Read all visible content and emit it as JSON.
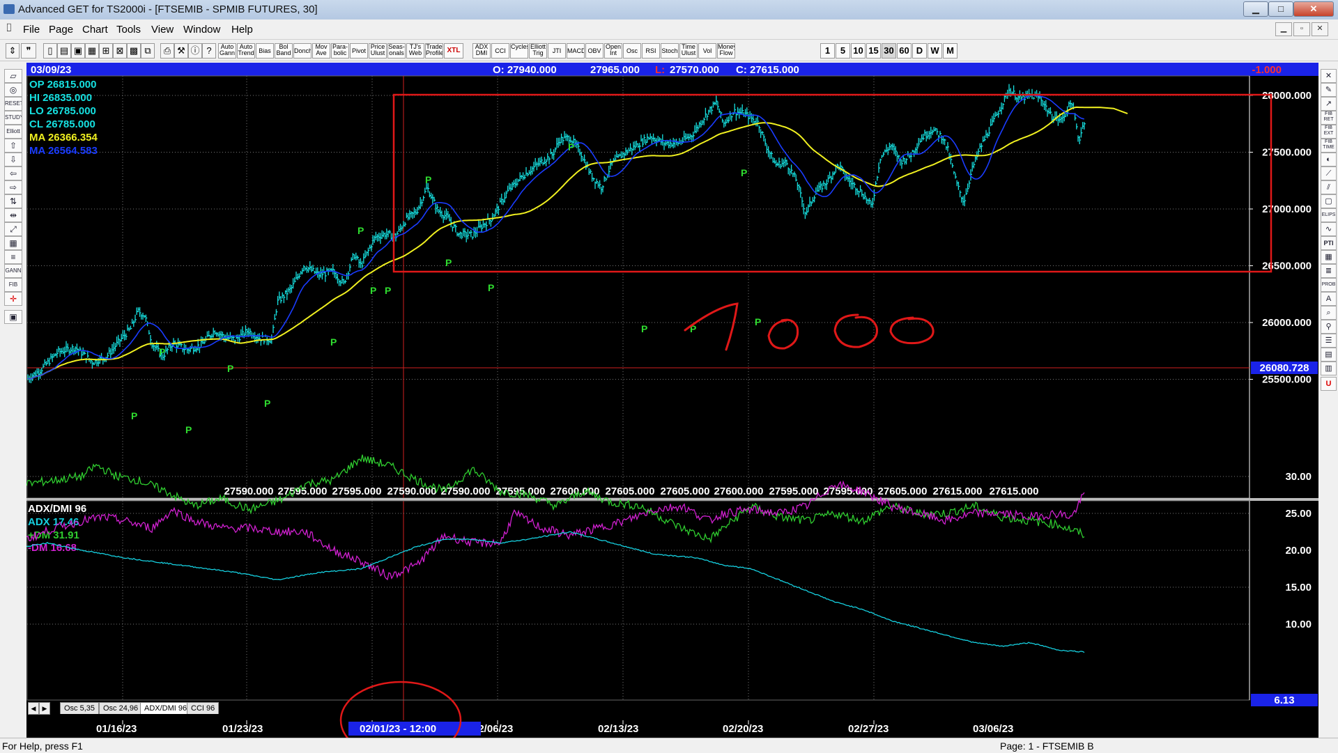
{
  "window": {
    "title": "Advanced GET for TS2000i - [FTSEMIB - SPMIB FUTURES, 30]",
    "minimize": "▁",
    "maximize": "□",
    "close": "✕"
  },
  "menu": {
    "items": [
      "File",
      "Page",
      "Chart",
      "Tools",
      "View",
      "Window",
      "Help"
    ],
    "mdi_buttons": [
      "▁",
      "▫",
      "✕"
    ]
  },
  "toolbar": {
    "study_buttons": [
      "Auto Gann",
      "Auto Trend",
      "Bias",
      "Bol Band",
      "Donch",
      "Mov Ave",
      "Para-bolic",
      "Pivot",
      "Price Ulust",
      "Seas-onals",
      "TJ's Web",
      "Trade Profile",
      "XTL",
      "ADX DMI",
      "CCI",
      "Cycles",
      "Elliott Trig",
      "JTI",
      "MACD",
      "OBV",
      "Open Int",
      "Osc",
      "RSI",
      "Stoch",
      "Time Ulust",
      "Vol",
      "Money Flow"
    ],
    "periods": [
      "1",
      "5",
      "10",
      "15",
      "30",
      "60",
      "D",
      "W",
      "M"
    ],
    "active_period": "30"
  },
  "chart": {
    "date": "03/09/23",
    "open_label": "O: 27940.000",
    "high_value": "27965.000",
    "low_label": "L:",
    "low_value": "27570.000",
    "close_label": "C: 27615.000",
    "change": "-1.000",
    "indicators": {
      "op": "OP  26815.000",
      "hi": "HI   26835.000",
      "lo": "LO  26785.000",
      "cl": "CL  26785.000",
      "ma1": "MA  26366.354",
      "ma2": "MA  26564.583"
    },
    "price_axis": [
      "28000.000",
      "27500.000",
      "27000.000",
      "26500.000",
      "26000.000",
      "25500.000"
    ],
    "crosshair_price": "26080.728",
    "bottom_values": [
      "27590.000",
      "27595.000",
      "27595.000",
      "27590.000",
      "27590.000",
      "27595.000",
      "27600.000",
      "27605.000",
      "27605.000",
      "27600.000",
      "27595.000",
      "27595.000",
      "27605.000",
      "27615.000",
      "27615.000"
    ],
    "pivot_label": "P",
    "annotation_text": "1000",
    "colors": {
      "price_bars": "#16e0e0",
      "ma_fast": "#1a3cff",
      "ma_slow": "#f0f020",
      "pivot": "#2fdd2f",
      "annotation": "#e01818",
      "header_bar": "#1a23e8"
    }
  },
  "adx_panel": {
    "title": "ADX/DMI 96",
    "adx": "ADX 17.46",
    "plus_dm": "+DM 31.91",
    "minus_dm": "-DM  16.68",
    "axis": [
      "30.00",
      "25.00",
      "20.00",
      "15.00",
      "10.00"
    ],
    "current": "6.13",
    "colors": {
      "adx": "#16d0e0",
      "plus_dm": "#2fcc2f",
      "minus_dm": "#d020d0"
    }
  },
  "tabs": {
    "nav": [
      "◀",
      "▶"
    ],
    "items": [
      "Osc 5,35",
      "Osc 24,96",
      "ADX/DMI 96",
      "CCI 96"
    ],
    "active": "ADX/DMI 96"
  },
  "time_axis": {
    "labels": [
      "01/16/23",
      "01/23/23",
      "01",
      "02/06/23",
      "02/13/23",
      "02/20/23",
      "02/27/23",
      "03/06/23"
    ],
    "crosshair_time": "02/01/23 - 12:00"
  },
  "status": {
    "help": "For Help, press F1",
    "page": "Page: 1 - FTSEMIB B"
  }
}
